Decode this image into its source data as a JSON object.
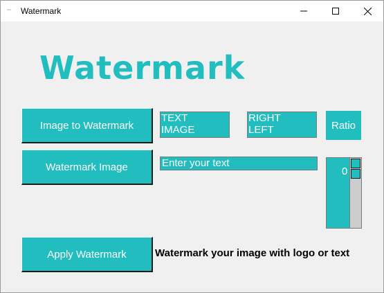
{
  "window": {
    "title": "Watermark"
  },
  "header": {
    "logo_text": "Watermark"
  },
  "buttons": {
    "image_to_watermark": "Image to Watermark",
    "watermark_image": "Watermark Image",
    "apply_watermark": "Apply Watermark",
    "ratio": "Ratio"
  },
  "type_list": {
    "items": [
      "TEXT",
      "IMAGE"
    ]
  },
  "position_list": {
    "items": [
      "RIGHT",
      "LEFT"
    ]
  },
  "text_entry": {
    "value": "Enter your text"
  },
  "ratio_spinbox": {
    "value": "0"
  },
  "caption": "Watermark your image with logo or text",
  "colors": {
    "accent": "#21bdbf",
    "background": "#f0f0f0",
    "text_on_accent": "#ffffff"
  },
  "icons": {
    "minimize": "minimize-icon",
    "maximize": "maximize-icon",
    "close": "close-icon"
  }
}
